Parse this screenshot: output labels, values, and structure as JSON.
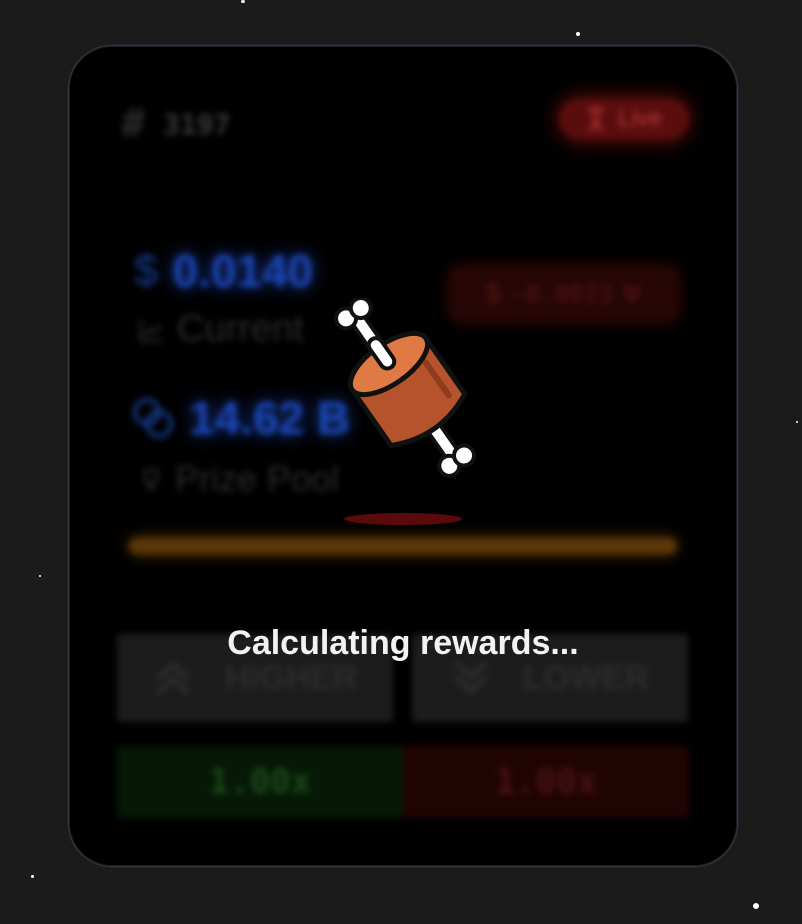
{
  "header": {
    "hash_symbol": "#",
    "round_number": "3197",
    "live_label": "Live"
  },
  "price": {
    "currency_symbol": "$",
    "value": "0.0140",
    "label": "Current"
  },
  "delta": {
    "currency_symbol": "$",
    "value": "-0.0023",
    "direction_icon": "chevrons-down-icon"
  },
  "pool": {
    "value": "14.62 B",
    "label": "Prize Pool"
  },
  "progress": {
    "fraction": 1.0
  },
  "buttons": {
    "higher_label": "HIGHER",
    "lower_label": "LOWER"
  },
  "multipliers": {
    "up": "1.00x",
    "down": "1.00x"
  },
  "overlay": {
    "status": "Calculating rewards..."
  },
  "colors": {
    "background": "#1b1b1c",
    "card": "#000000",
    "price_blue": "#1c47b8",
    "live_red": "#5a0d0d",
    "status_text": "#f2f2f2",
    "meat_orange": "#e07a45"
  }
}
